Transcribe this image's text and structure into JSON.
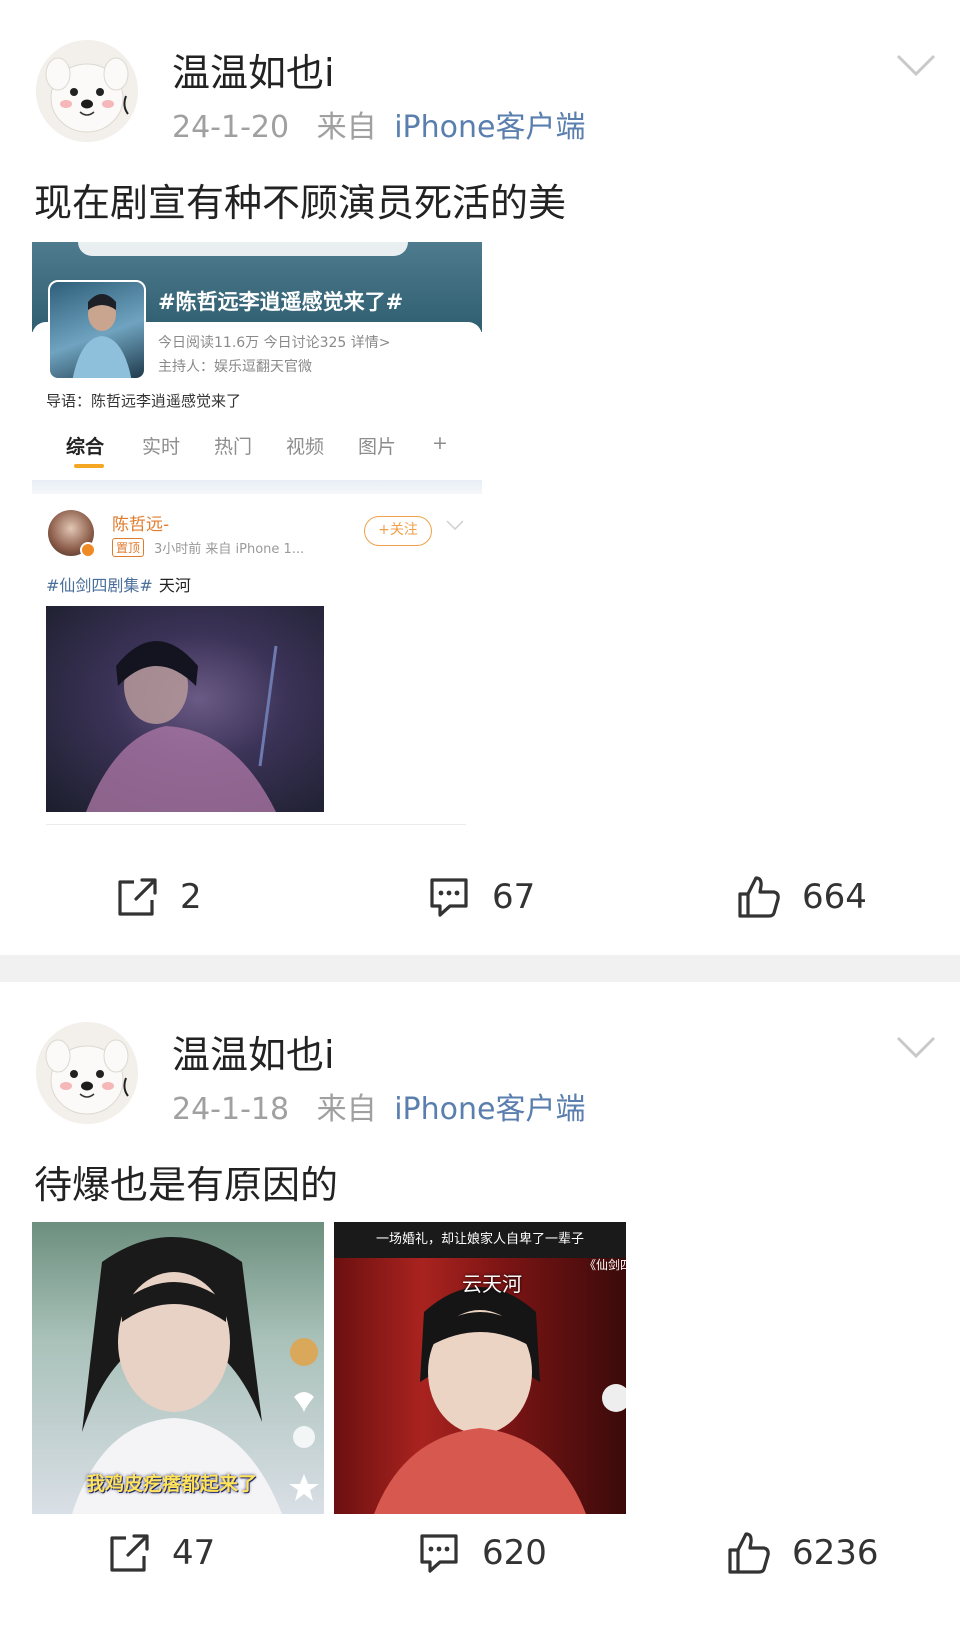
{
  "posts": [
    {
      "username": "温温如也i",
      "date": "24-1-20",
      "source_prefix": "来自",
      "source": "iPhone客户端",
      "text": "现在剧宣有种不顾演员死活的美",
      "embedded_screenshot": {
        "topic": "#陈哲远李逍遥感觉来了#",
        "stats": "今日阅读11.6万  今日讨论325  详情>",
        "host": "主持人：娱乐逗翻天官微",
        "lead": "导语：陈哲远李逍遥感觉来了",
        "tabs": [
          "综合",
          "实时",
          "热门",
          "视频",
          "图片",
          "+"
        ],
        "active_tab": "综合",
        "post_author": "陈哲远-",
        "post_pin": "置顶",
        "post_meta": "3小时前  来自 iPhone 1...",
        "follow_label": "+关注",
        "hashtag": "#仙剑四剧集#",
        "post_text": "天河"
      },
      "actions": {
        "reposts": "2",
        "comments": "67",
        "likes": "664"
      }
    },
    {
      "username": "温温如也i",
      "date": "24-1-18",
      "source_prefix": "来自",
      "source": "iPhone客户端",
      "text": "待爆也是有原因的",
      "images": [
        {
          "caption": "我鸡皮疙瘩都起来了"
        },
        {
          "top_caption": "一场婚礼，却让娘家人自卑了一辈子",
          "name_caption": "云天河",
          "drama_label": "《仙剑四"
        }
      ],
      "actions": {
        "reposts": "47",
        "comments": "620",
        "likes": "6236"
      }
    }
  ],
  "icons": {
    "menu": "chevron-down-icon",
    "repost": "share-icon",
    "comment": "comment-icon",
    "like": "thumbs-up-icon"
  },
  "colors": {
    "source_link": "#5a7fae",
    "meta_gray": "#a0a0a0",
    "divider": "#f1f1f1",
    "embed_orange": "#f5a623"
  }
}
